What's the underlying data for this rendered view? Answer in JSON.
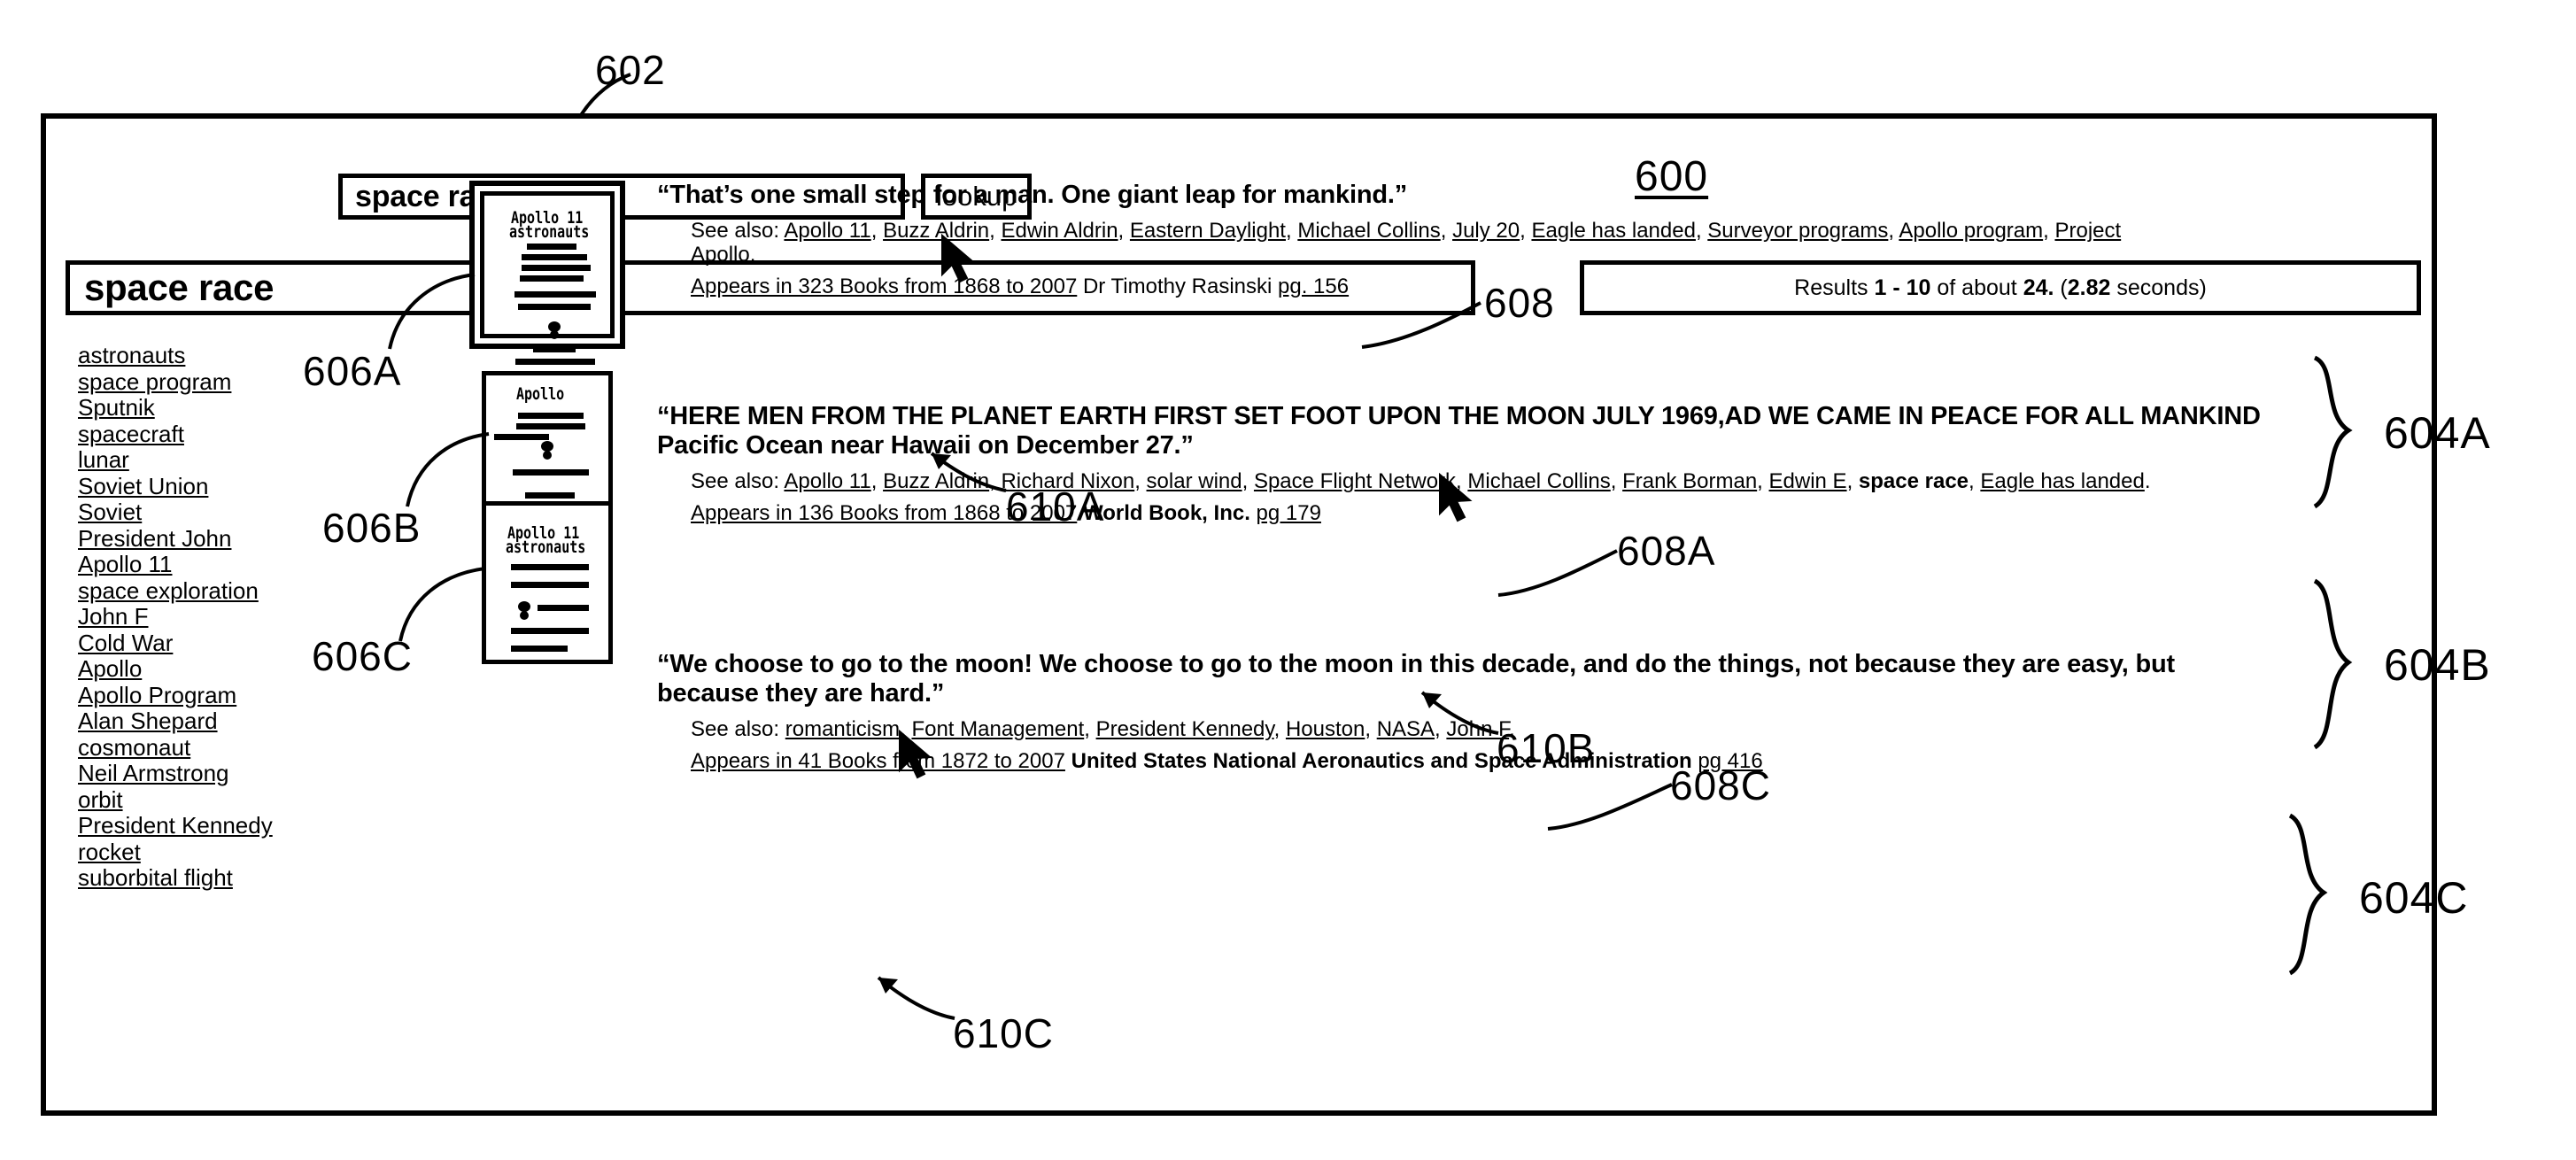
{
  "figure": {
    "number_labels": {
      "fig600": "600",
      "fig602": "602",
      "fig604A": "604A",
      "fig604B": "604B",
      "fig604C": "604C",
      "fig606A": "606A",
      "fig606B": "606B",
      "fig606C": "606C",
      "fig608": "608",
      "fig608A": "608A",
      "fig608C": "608C",
      "fig610A": "610A",
      "fig610B": "610B",
      "fig610C": "610C"
    }
  },
  "search": {
    "query_value": "space race",
    "placeholder": "",
    "lookup_label": "lookup"
  },
  "header": {
    "title": "space race",
    "results_prefix": "Results",
    "results_range": "1 - 10",
    "results_middle": "of about",
    "results_count": "24.",
    "results_open_paren": "(",
    "results_seconds_value": "2.82",
    "results_seconds_label": "seconds)"
  },
  "sidebar": {
    "terms": [
      "astronauts",
      "space program",
      "Sputnik",
      "spacecraft",
      "lunar",
      "Soviet Union",
      "Soviet",
      "President John",
      "Apollo 11",
      "space exploration",
      "John F",
      "Cold War",
      "Apollo",
      "Apollo Program",
      "Alan Shepard",
      "cosmonaut",
      "Neil Armstrong",
      "orbit",
      "President Kennedy",
      "rocket",
      "suborbital flight"
    ]
  },
  "results": [
    {
      "id": "604A",
      "quote": "“That’s one small step for a man. One giant leap for mankind.”",
      "see_also_label": "See also:",
      "see_also_links": [
        "Apollo 11",
        "Buzz Aldrin",
        "Edwin Aldrin",
        "Eastern Daylight",
        "Michael Collins",
        "July 20",
        "Eagle has landed",
        "Surveyor programs",
        "Apollo program",
        "Project Apollo"
      ],
      "appears_link": "Appears in 323 Books from 1868 to 2007",
      "author": "Dr Timothy Rasinski",
      "author_bold": false,
      "page_link": "pg. 156",
      "thumbnail_title": "Apollo 11\nastronauts"
    },
    {
      "id": "604B",
      "quote": "“HERE MEN FROM THE PLANET EARTH FIRST SET FOOT UPON THE MOON JULY 1969,AD WE CAME IN PEACE FOR ALL MANKIND Pacific Ocean near Hawaii on December 27.”",
      "see_also_label": "See also:",
      "see_also_links": [
        "Apollo 11",
        "Buzz Aldrin",
        "Richard Nixon",
        "solar wind",
        "Space Flight Network",
        "Michael Collins",
        "Frank Borman",
        "Edwin E",
        "space race",
        "Eagle has landed"
      ],
      "see_also_bold_plain": "space race",
      "appears_link": "Appears in 136 Books from 1868 to 2007",
      "author": "World Book, Inc.",
      "author_bold": true,
      "page_link": "pg 179",
      "thumbnail_title": "Apollo"
    },
    {
      "id": "604C",
      "quote": "“We choose to go to the moon! We choose to go to the moon in this decade, and do the things, not because they are easy, but because they are hard.”",
      "see_also_label": "See also:",
      "see_also_links": [
        "romanticism",
        "Font Management",
        "President Kennedy",
        "Houston",
        "NASA",
        "John F"
      ],
      "appears_link": "Appears in 41 Books from 1872 to 2007",
      "author": "United States National Aeronautics and Space Administration",
      "author_bold": true,
      "page_link": "pg 416",
      "thumbnail_title": "Apollo 11\nastronauts"
    }
  ],
  "thumbnails": {
    "scribble_a_line1": "Apollo 11",
    "scribble_a_line2": "astronauts",
    "scribble_b_line1": "Apollo",
    "scribble_c_line1": "Apollo 11",
    "scribble_c_line2": "astronauts"
  }
}
